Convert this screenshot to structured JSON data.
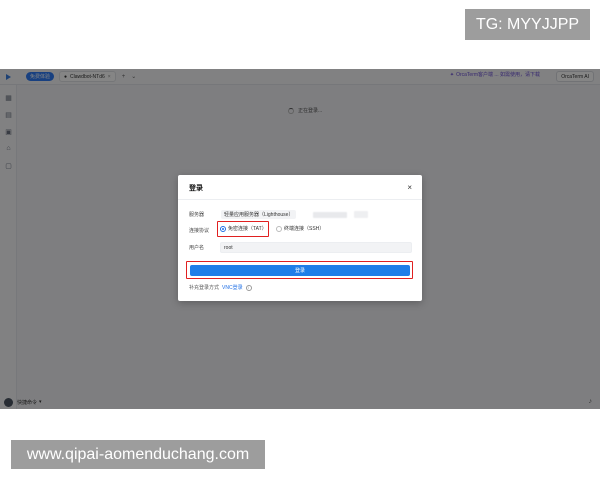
{
  "watermarks": {
    "tg": "TG: MYYJJPP",
    "url": "www.qipai-aomenduchang.com"
  },
  "topbar": {
    "badge": "免费体验",
    "tab_label": "Clawdbot-NTd6",
    "promo_text": "OrcaTerm客户端 ... 如需使用，请下载",
    "promo_button": "OrcaTerm AI"
  },
  "main": {
    "loading_text": "正在登录..."
  },
  "bottom": {
    "quick_commands": "快捷命令"
  },
  "dialog": {
    "title": "登录",
    "close": "×",
    "server_label": "服务器",
    "server_value": "轻量应用服务器（Lighthouse）",
    "protocol_label": "连接协议",
    "protocol_options": [
      {
        "label": "免密连接（TAT）",
        "selected": true
      },
      {
        "label": "终端连接（SSH）",
        "selected": false
      }
    ],
    "username_label": "用户名",
    "username_value": "root",
    "login_button": "登录",
    "extra_label": "补充登录方式",
    "extra_link": "VNC登录",
    "info_icon_glyph": "i"
  },
  "colors": {
    "accent": "#1f7ee8",
    "highlight": "#e02020",
    "overlay": "rgba(0,0,0,0.48)"
  }
}
